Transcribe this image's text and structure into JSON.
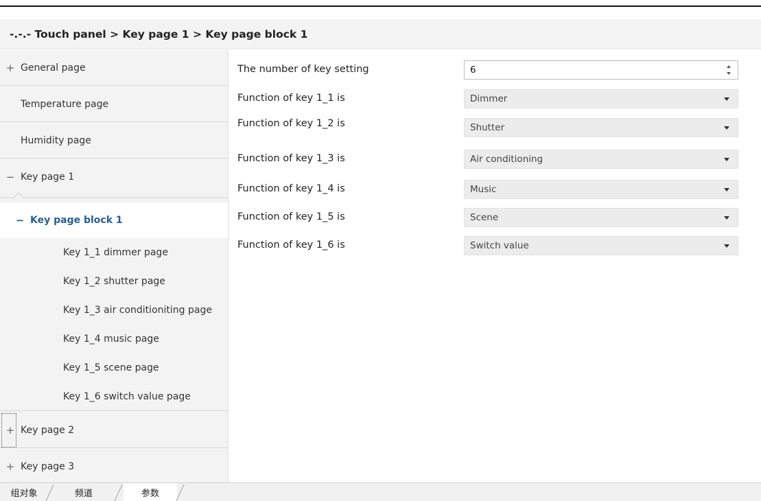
{
  "breadcrumb": {
    "text": "-.-.- Touch panel > Key page 1 > Key page block 1"
  },
  "sidebar": {
    "items": [
      {
        "toggle": "+",
        "label": "General page"
      },
      {
        "toggle": "",
        "label": "Temperature page"
      },
      {
        "toggle": "",
        "label": "Humidity page"
      },
      {
        "toggle": "−",
        "label": "Key page 1"
      },
      {
        "toggle": "−",
        "label": "Key page block 1"
      },
      {
        "toggle": "",
        "label": "Key 1_1 dimmer page"
      },
      {
        "toggle": "",
        "label": "Key 1_2 shutter page"
      },
      {
        "toggle": "",
        "label": "Key 1_3 air conditioniting page"
      },
      {
        "toggle": "",
        "label": "Key 1_4 music page"
      },
      {
        "toggle": "",
        "label": "Key 1_5 scene page"
      },
      {
        "toggle": "",
        "label": "Key 1_6 switch value page"
      },
      {
        "toggle": "+",
        "label": "Key page 2"
      },
      {
        "toggle": "+",
        "label": "Key page 3"
      }
    ]
  },
  "params": [
    {
      "label": "The number of key setting",
      "value": "6",
      "kind": "spin"
    },
    {
      "label": "Function of key 1_1 is",
      "value": "Dimmer",
      "kind": "select"
    },
    {
      "label": "Function of key 1_2 is",
      "value": "Shutter",
      "kind": "select"
    },
    {
      "label": "Function of key 1_3 is",
      "value": "Air conditioning",
      "kind": "select"
    },
    {
      "label": "Function of key 1_4 is",
      "value": "Music",
      "kind": "select"
    },
    {
      "label": "Function of key 1_5 is",
      "value": "Scene",
      "kind": "select"
    },
    {
      "label": "Function of key 1_6 is",
      "value": "Switch value",
      "kind": "select"
    }
  ],
  "tabs": [
    {
      "label": "组对象"
    },
    {
      "label": "频道"
    },
    {
      "label": "参数",
      "active": true
    }
  ]
}
